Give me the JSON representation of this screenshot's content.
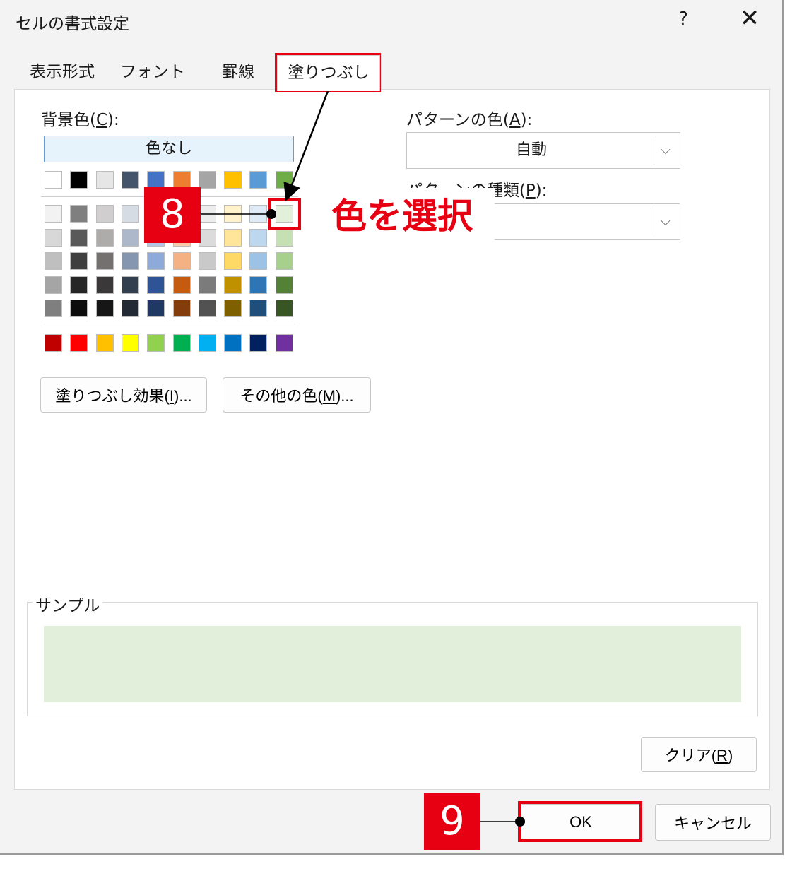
{
  "dialog": {
    "title": "セルの書式設定",
    "help_glyph": "?",
    "close_glyph": "✕"
  },
  "tabs": [
    {
      "label": "表示形式",
      "active": false
    },
    {
      "label": "フォント",
      "active": false
    },
    {
      "label": "罫線",
      "active": false
    },
    {
      "label": "塗りつぶし",
      "active": true
    }
  ],
  "background": {
    "label": "背景色(C):",
    "no_color_label": "色なし",
    "theme_top_row": [
      "#ffffff",
      "#000000",
      "#e7e6e6",
      "#44546a",
      "#4472c4",
      "#ed7d31",
      "#a5a5a5",
      "#ffc000",
      "#5b9bd5",
      "#70ad47"
    ],
    "theme_shades": [
      [
        "#f2f2f2",
        "#7f7f7f",
        "#d0cece",
        "#d6dce4",
        "#d9e2f3",
        "#fbe5d5",
        "#ededed",
        "#fff2cc",
        "#deebf6",
        "#e2efd9"
      ],
      [
        "#d8d8d8",
        "#595959",
        "#aeabab",
        "#adb9ca",
        "#b4c6e7",
        "#f7cbac",
        "#dbdbdb",
        "#fee599",
        "#bdd7ee",
        "#c5e0b3"
      ],
      [
        "#bfbfbf",
        "#3f3f3f",
        "#757070",
        "#8496b0",
        "#8eaadb",
        "#f4b183",
        "#c9c9c9",
        "#ffd965",
        "#9cc3e5",
        "#a8d08d"
      ],
      [
        "#a5a5a5",
        "#262626",
        "#3a3838",
        "#323f4f",
        "#2f5496",
        "#c55a11",
        "#7b7b7b",
        "#bf9000",
        "#2e75b5",
        "#538135"
      ],
      [
        "#7f7f7f",
        "#0c0c0c",
        "#171616",
        "#222a35",
        "#1f3864",
        "#833c0b",
        "#525252",
        "#7f6000",
        "#1e4e79",
        "#375623"
      ]
    ],
    "standard_colors": [
      "#c00000",
      "#ff0000",
      "#ffc000",
      "#ffff00",
      "#92d050",
      "#00b050",
      "#00b0f0",
      "#0070c0",
      "#002060",
      "#7030a0"
    ],
    "fill_effects_button": "塗りつぶし効果(I)...",
    "more_colors_button": "その他の色(M)..."
  },
  "pattern": {
    "color_label": "パターンの色(A):",
    "color_value": "自動",
    "style_label": "パターンの種類(P):"
  },
  "sample": {
    "legend": "サンプル",
    "preview_color": "#e2efda"
  },
  "buttons": {
    "clear": "クリア(R)",
    "ok": "OK",
    "cancel": "キャンセル"
  },
  "annotations": {
    "step8": "8",
    "step8_text": "色を選択",
    "step9": "9",
    "highlight_color": "#e60012"
  }
}
